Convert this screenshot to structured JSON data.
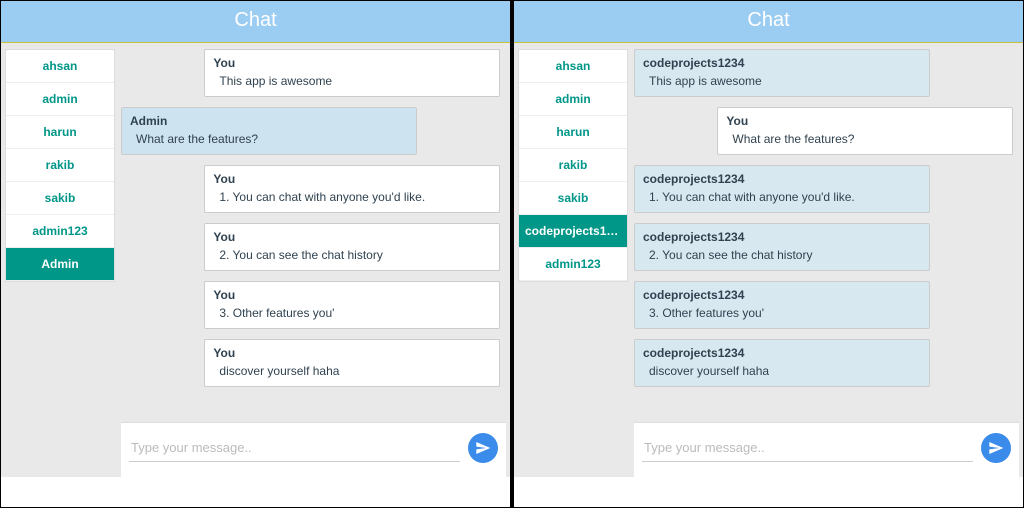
{
  "left": {
    "header": "Chat",
    "users": [
      {
        "name": "ahsan",
        "active": false
      },
      {
        "name": "admin",
        "active": false
      },
      {
        "name": "harun",
        "active": false
      },
      {
        "name": "rakib",
        "active": false
      },
      {
        "name": "sakib",
        "active": false
      },
      {
        "name": "admin123",
        "active": false
      },
      {
        "name": "Admin",
        "active": true
      }
    ],
    "messages": [
      {
        "sender": "You",
        "text": "This app is awesome",
        "mine": true
      },
      {
        "sender": "Admin",
        "text": "What are the features?",
        "mine": false,
        "sel": true
      },
      {
        "sender": "You",
        "text": "1. You can chat with anyone you'd like.",
        "mine": true
      },
      {
        "sender": "You",
        "text": "2. You can see the chat history",
        "mine": true
      },
      {
        "sender": "You",
        "text": "3. Other features you'",
        "mine": true
      },
      {
        "sender": "You",
        "text": "discover yourself haha",
        "mine": true
      }
    ],
    "composer_placeholder": "Type your message.."
  },
  "right": {
    "header": "Chat",
    "users": [
      {
        "name": "ahsan",
        "active": false
      },
      {
        "name": "admin",
        "active": false
      },
      {
        "name": "harun",
        "active": false
      },
      {
        "name": "rakib",
        "active": false
      },
      {
        "name": "sakib",
        "active": false
      },
      {
        "name": "codeprojects1234",
        "active": true
      },
      {
        "name": "admin123",
        "active": false
      }
    ],
    "messages": [
      {
        "sender": "codeprojects1234",
        "text": "This app is awesome",
        "mine": false
      },
      {
        "sender": "You",
        "text": "What are the features?",
        "mine": true
      },
      {
        "sender": "codeprojects1234",
        "text": "1. You can chat with anyone you'd like.",
        "mine": false
      },
      {
        "sender": "codeprojects1234",
        "text": "2. You can see the chat history",
        "mine": false
      },
      {
        "sender": "codeprojects1234",
        "text": "3. Other features you'",
        "mine": false
      },
      {
        "sender": "codeprojects1234",
        "text": "discover yourself haha",
        "mine": false
      }
    ],
    "composer_placeholder": "Type your message.."
  }
}
